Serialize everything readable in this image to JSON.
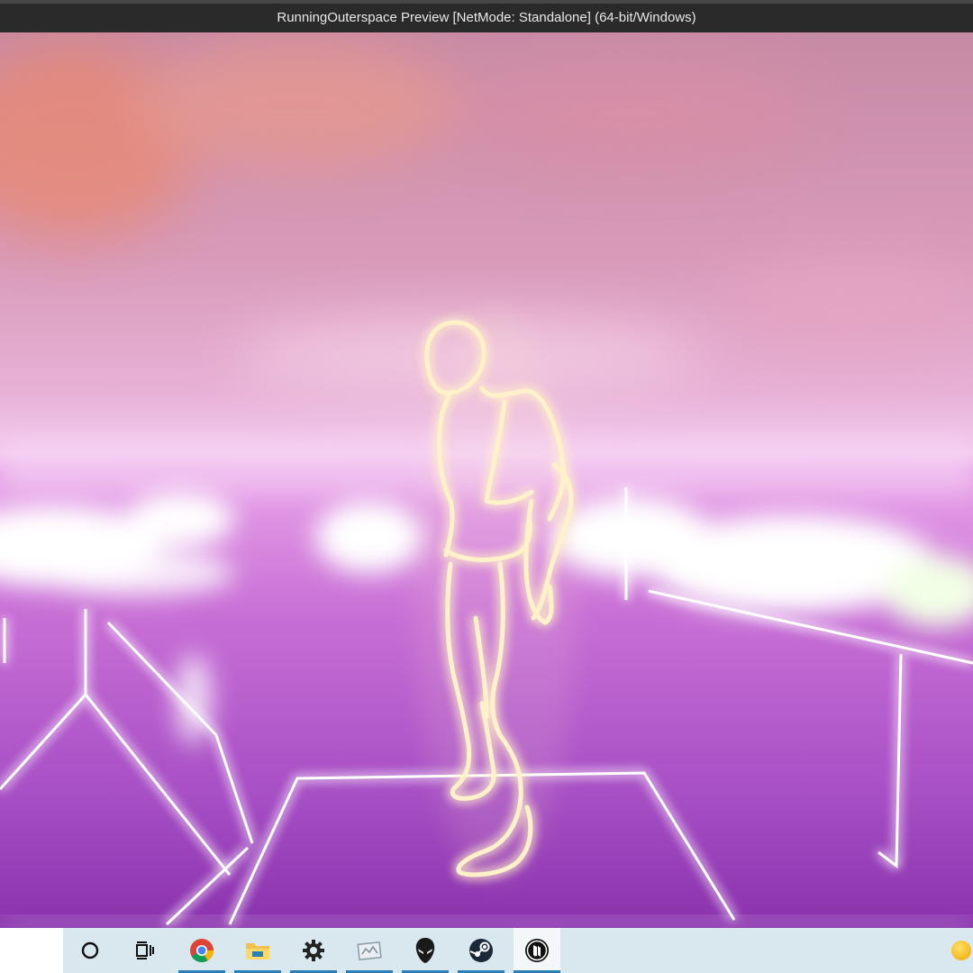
{
  "window": {
    "title": "RunningOuterspace Preview [NetMode: Standalone]  (64-bit/Windows)"
  },
  "viewport": {
    "scene": "glowing-mannequin-on-neon-grid"
  },
  "colors": {
    "titlebar": "#2a2a2a",
    "taskbar": "#d9e8ef",
    "active_indicator": "#2a7fb8",
    "glow": "#fff1c8"
  },
  "taskbar": {
    "items": [
      {
        "icon": "cortana-circle-icon",
        "active": false
      },
      {
        "icon": "task-view-icon",
        "active": false
      },
      {
        "icon": "chrome-icon",
        "active": true
      },
      {
        "icon": "file-explorer-icon",
        "active": true
      },
      {
        "icon": "settings-gear-icon",
        "active": true
      },
      {
        "icon": "image-viewer-icon",
        "active": true
      },
      {
        "icon": "alienware-icon",
        "active": true
      },
      {
        "icon": "steam-icon",
        "active": true
      },
      {
        "icon": "unreal-engine-icon",
        "active": true
      }
    ],
    "tray_icon": "notification-orb-icon"
  }
}
